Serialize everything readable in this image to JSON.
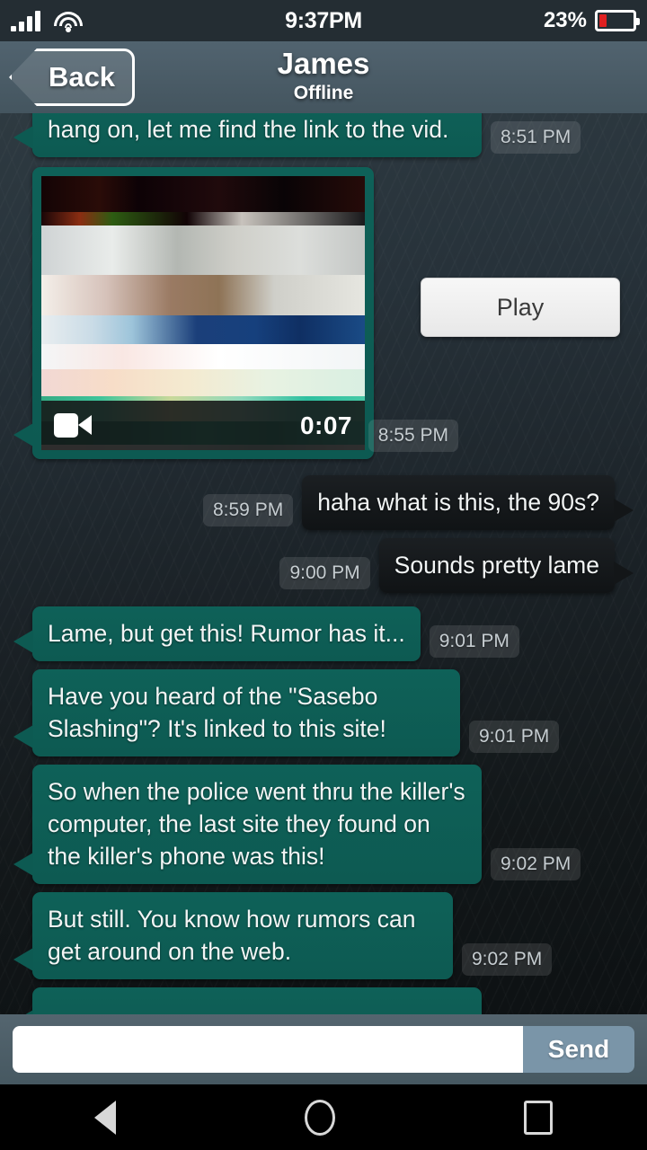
{
  "statusbar": {
    "time": "9:37PM",
    "battery_percent": "23%",
    "signal_icon": "signal-bars-icon",
    "wifi_icon": "wifi-icon",
    "battery_icon": "battery-icon",
    "battery_level": 23
  },
  "header": {
    "back_label": "Back",
    "title": "James",
    "status": "Offline",
    "bg_color": "#4a5c68"
  },
  "chat": {
    "incoming_bubble_color": "#0d5a52",
    "outgoing_bubble_color": "#131618",
    "messages": [
      {
        "type": "text",
        "side": "incoming",
        "text": "hang on, let me find the link to the vid.",
        "time": "8:51 PM"
      },
      {
        "type": "video",
        "side": "incoming",
        "duration": "0:07",
        "play_label": "Play",
        "time": "8:55 PM",
        "camera_icon": "video-camera-icon"
      },
      {
        "type": "text",
        "side": "outgoing",
        "text": "haha what is this, the 90s?",
        "time": "8:59 PM"
      },
      {
        "type": "text",
        "side": "outgoing",
        "text": "Sounds pretty lame",
        "time": "9:00 PM"
      },
      {
        "type": "text",
        "side": "incoming",
        "text": "Lame, but get this! Rumor has it...",
        "time": "9:01 PM"
      },
      {
        "type": "text",
        "side": "incoming",
        "text": "Have you heard of the \"Sasebo Slashing\"? It's linked to this site!",
        "time": "9:01 PM"
      },
      {
        "type": "text",
        "side": "incoming",
        "text": "So when the police went thru the killer's computer, the last site they found on the killer's phone was this!",
        "time": "9:02 PM"
      },
      {
        "type": "text",
        "side": "incoming",
        "text": "But still. You know how rumors can get around on the web.",
        "time": "9:02 PM"
      }
    ]
  },
  "composer": {
    "input_value": "",
    "input_placeholder": "",
    "send_label": "Send"
  },
  "navbar": {
    "back_icon": "android-back-icon",
    "home_icon": "android-home-icon",
    "recents_icon": "android-recents-icon"
  }
}
